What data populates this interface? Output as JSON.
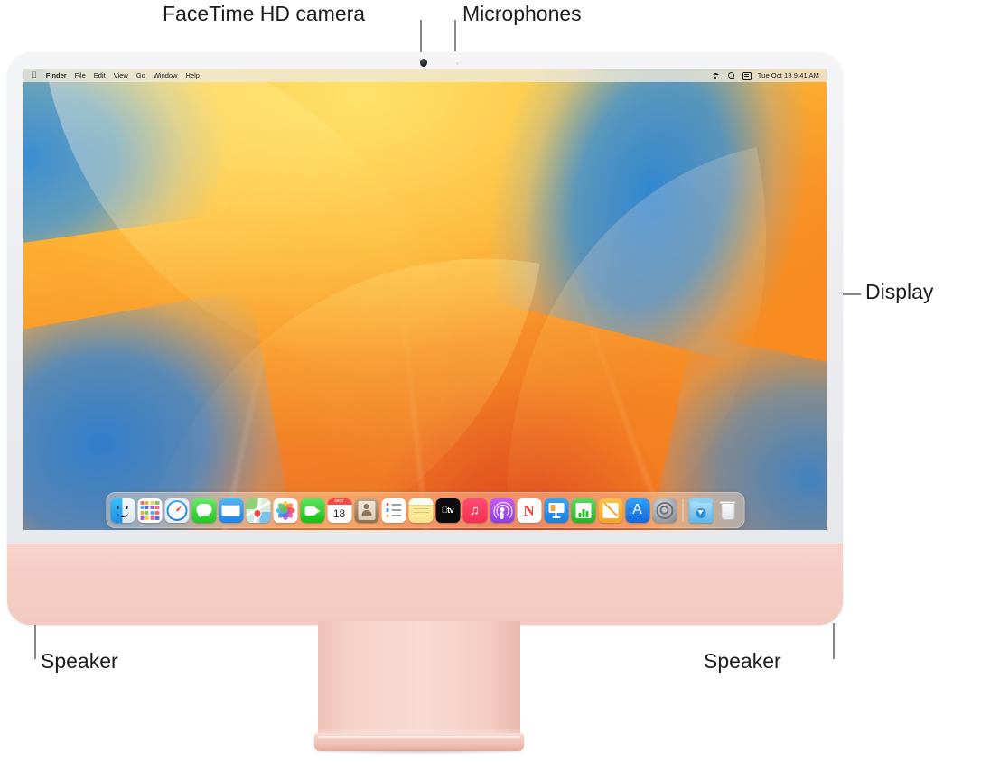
{
  "callouts": {
    "facetime_camera": "FaceTime HD camera",
    "microphones": "Microphones",
    "display": "Display",
    "speaker_left": "Speaker",
    "speaker_right": "Speaker"
  },
  "screen": {
    "menubar": {
      "apple_logo": "",
      "app_menus": [
        {
          "label": "Finder",
          "bold": true
        },
        {
          "label": "File",
          "bold": false
        },
        {
          "label": "Edit",
          "bold": false
        },
        {
          "label": "View",
          "bold": false
        },
        {
          "label": "Go",
          "bold": false
        },
        {
          "label": "Window",
          "bold": false
        },
        {
          "label": "Help",
          "bold": false
        }
      ],
      "status_icons": [
        "wifi-icon",
        "search-icon",
        "control-center-icon"
      ],
      "clock": "Tue Oct 18  9:41 AM"
    },
    "wallpaper": {
      "name": "macos-ventura-wallpaper",
      "colors": {
        "yellow": "#ffd24a",
        "orange": "#f89228",
        "deep_orange": "#ec6b22",
        "red": "#cd3020",
        "blue": "#358cd6"
      }
    },
    "dock": {
      "items": [
        {
          "name": "finder",
          "label": "Finder",
          "running": true
        },
        {
          "name": "launchpad",
          "label": "Launchpad",
          "running": false
        },
        {
          "name": "safari",
          "label": "Safari",
          "running": false
        },
        {
          "name": "messages",
          "label": "Messages",
          "running": false
        },
        {
          "name": "mail",
          "label": "Mail",
          "running": false
        },
        {
          "name": "maps",
          "label": "Maps",
          "running": false
        },
        {
          "name": "photos",
          "label": "Photos",
          "running": false
        },
        {
          "name": "facetime",
          "label": "FaceTime",
          "running": false
        },
        {
          "name": "calendar",
          "label": "Calendar",
          "running": false
        },
        {
          "name": "contacts",
          "label": "Contacts",
          "running": false
        },
        {
          "name": "reminders",
          "label": "Reminders",
          "running": false
        },
        {
          "name": "notes",
          "label": "Notes",
          "running": false
        },
        {
          "name": "tv",
          "label": "Apple TV",
          "running": false
        },
        {
          "name": "music",
          "label": "Music",
          "running": false
        },
        {
          "name": "podcasts",
          "label": "Podcasts",
          "running": false
        },
        {
          "name": "news",
          "label": "News",
          "running": false
        },
        {
          "name": "keynote",
          "label": "Keynote",
          "running": false
        },
        {
          "name": "numbers",
          "label": "Numbers",
          "running": false
        },
        {
          "name": "pages",
          "label": "Pages",
          "running": false
        },
        {
          "name": "app-store",
          "label": "App Store",
          "running": false
        },
        {
          "name": "system-settings",
          "label": "System Settings",
          "running": false
        },
        {
          "name": "downloads",
          "label": "Downloads",
          "running": false
        },
        {
          "name": "trash",
          "label": "Trash",
          "running": false
        }
      ],
      "calendar_month": "OCT",
      "calendar_day": "18",
      "tv_label": "tv",
      "news_letter": "N",
      "appstore_letter": "A",
      "music_note": "♫"
    }
  },
  "device": {
    "name": "iMac",
    "chassis_color": "#f4cdc4",
    "bezel_color": "#edeff2"
  }
}
